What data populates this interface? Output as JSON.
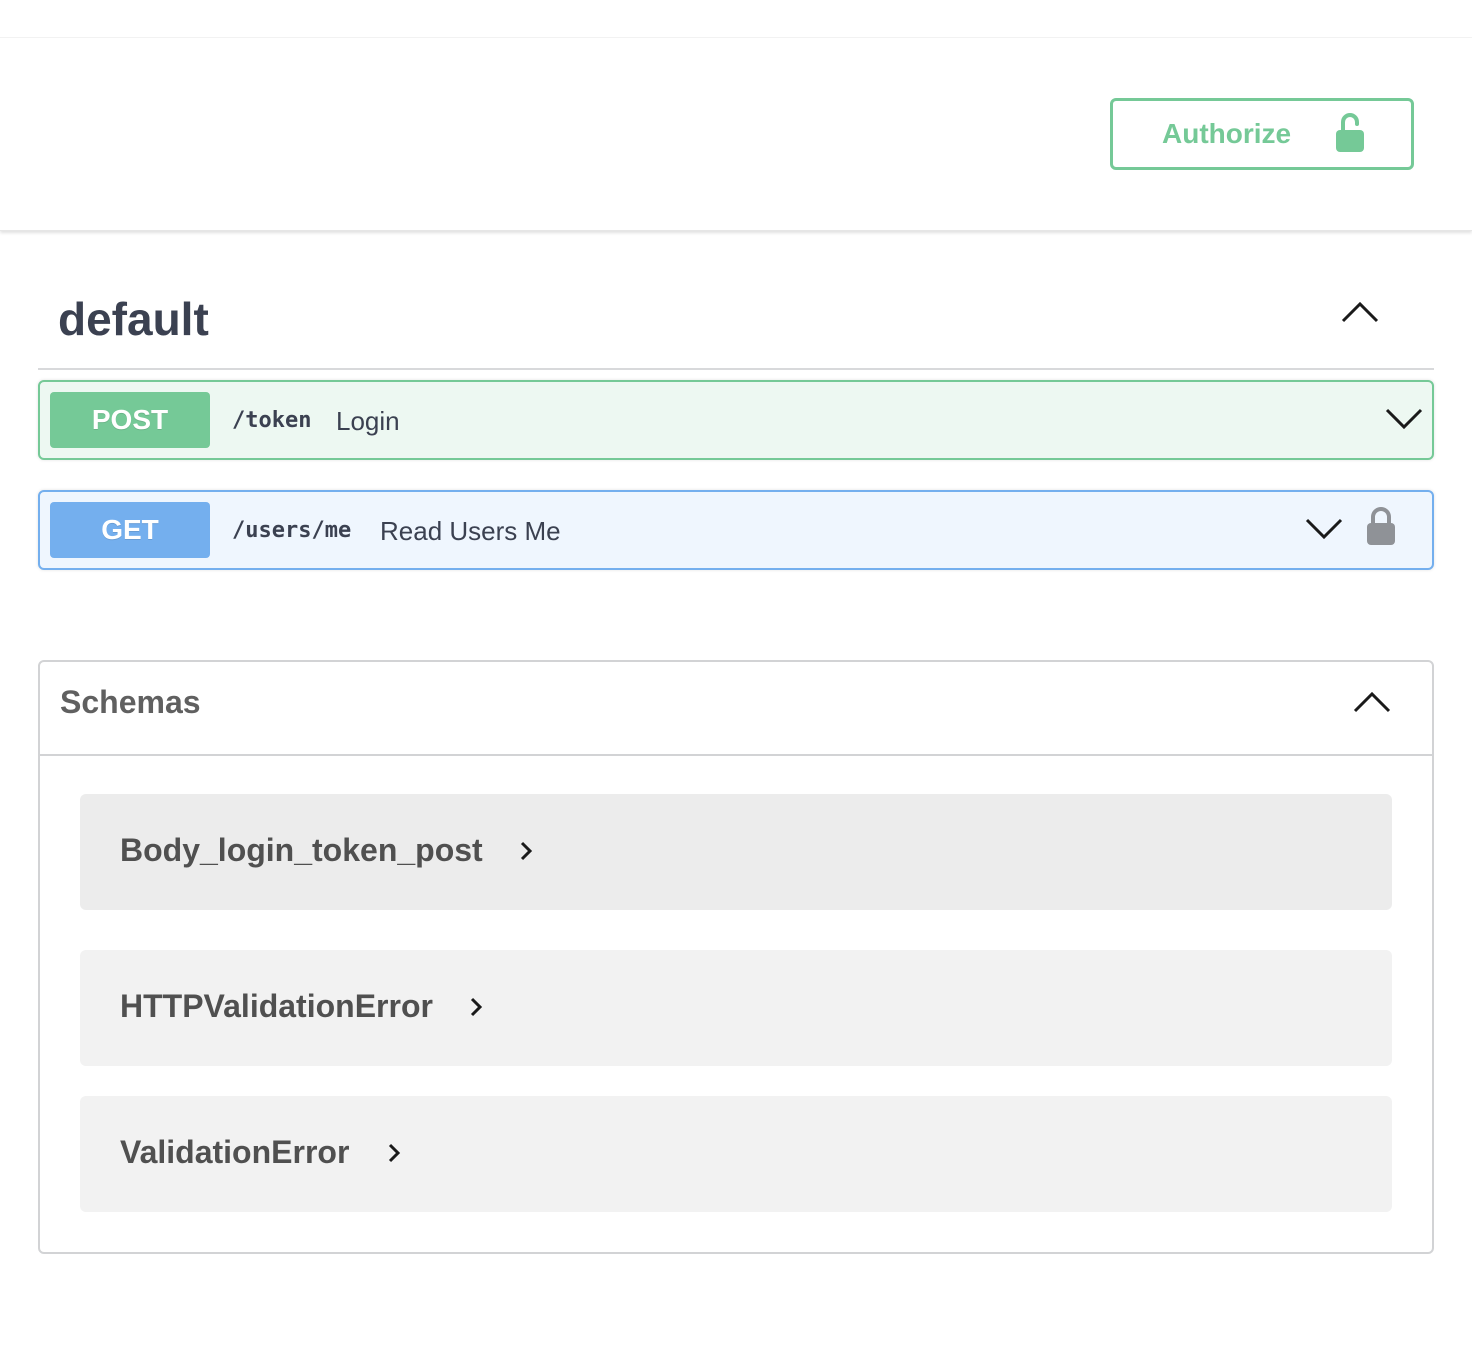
{
  "authorize": {
    "label": "Authorize",
    "icon": "lock-open-icon",
    "color": "#75c997"
  },
  "tag": {
    "title": "default",
    "toggle_icon": "chevron-up-icon"
  },
  "operations": [
    {
      "method": "POST",
      "path": "/token",
      "summary": "Login",
      "color": "#75c997",
      "arrow_icon": "chevron-down-icon"
    },
    {
      "method": "GET",
      "path": "/users/me",
      "summary": "Read Users Me",
      "color": "#74afee",
      "arrow_icon": "chevron-down-icon",
      "lock_icon": "lock-icon"
    }
  ],
  "schemas": {
    "title": "Schemas",
    "toggle_icon": "chevron-up-icon",
    "items": [
      {
        "name": "Body_login_token_post",
        "icon": "chevron-right-icon"
      },
      {
        "name": "HTTPValidationError",
        "icon": "chevron-right-icon"
      },
      {
        "name": "ValidationError",
        "icon": "chevron-right-icon"
      }
    ]
  }
}
